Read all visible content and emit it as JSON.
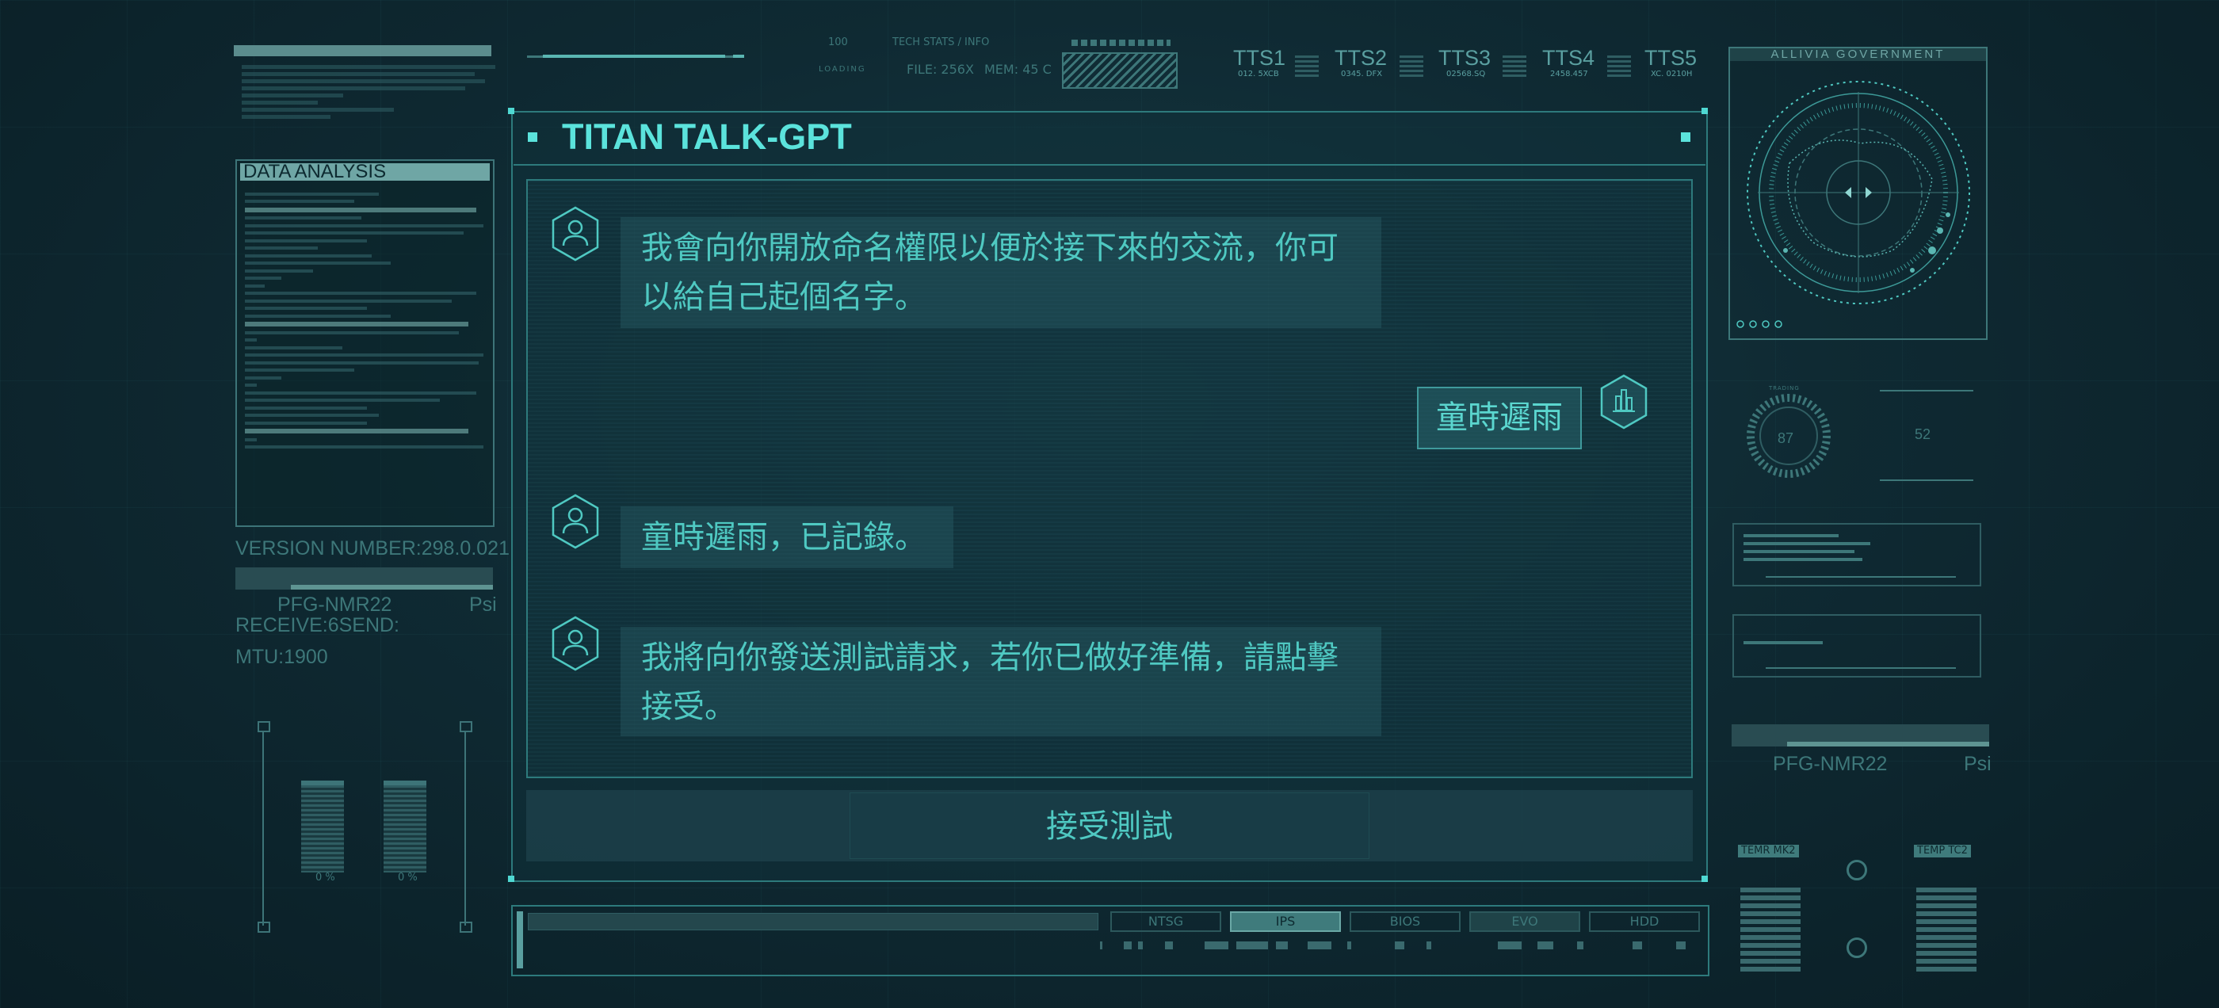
{
  "left_panel": {
    "data_analysis_title": "DATA ANALYSIS",
    "version_number": "VERSION NUMBER:298.0.021",
    "pfg_label": "PFG-NMR22",
    "psi_label": "Psi",
    "receive_send": "RECEIVE:6SEND:",
    "mtu": "MTU:1900",
    "slider_pct_1": "0 %",
    "slider_pct_2": "0 %"
  },
  "top_strip": {
    "scale_100": "100",
    "loading": "LOADING",
    "tech_stats": "TECH STATS / INFO",
    "file": "FILE: 256X",
    "mem": "MEM: 45 C",
    "tts": [
      {
        "label": "TTS1",
        "sub": "012. 5XCB"
      },
      {
        "label": "TTS2",
        "sub": "0345. DFX"
      },
      {
        "label": "TTS3",
        "sub": "02568.SQ"
      },
      {
        "label": "TTS4",
        "sub": "2458.457"
      },
      {
        "label": "TTS5",
        "sub": "XC. 0210H"
      }
    ]
  },
  "dialog": {
    "title": "TITAN TALK-GPT",
    "messages": [
      {
        "role": "assistant",
        "text": "我會向你開放命名權限以便於接下來的交流，你可以給自己起個名字。"
      },
      {
        "role": "user",
        "text": "童時遲雨"
      },
      {
        "role": "assistant",
        "text": "童時遲雨，已記錄。"
      },
      {
        "role": "assistant",
        "text": "我將向你發送測試請求，若你已做好準備，請點擊接受。"
      }
    ],
    "accept_button": "接受測試"
  },
  "status_bar": {
    "tabs": [
      "NTSG",
      "IPS",
      "BIOS",
      "EVO",
      "HDD"
    ],
    "active_tab": "IPS"
  },
  "right_panel": {
    "gov_title": "ALLIVIA GOVERNMENT",
    "gauge_value": "87",
    "gauge_label": "TRADING",
    "side_value": "52",
    "pfg_label": "PFG-NMR22",
    "psi_label": "Psi",
    "temp_left": "TEMR MK2",
    "temp_right": "TEMP TC2"
  },
  "colors": {
    "accent": "#5be3dc",
    "text": "#4fc9c2",
    "border": "#2d7a7c",
    "background": "#0f2a33"
  }
}
